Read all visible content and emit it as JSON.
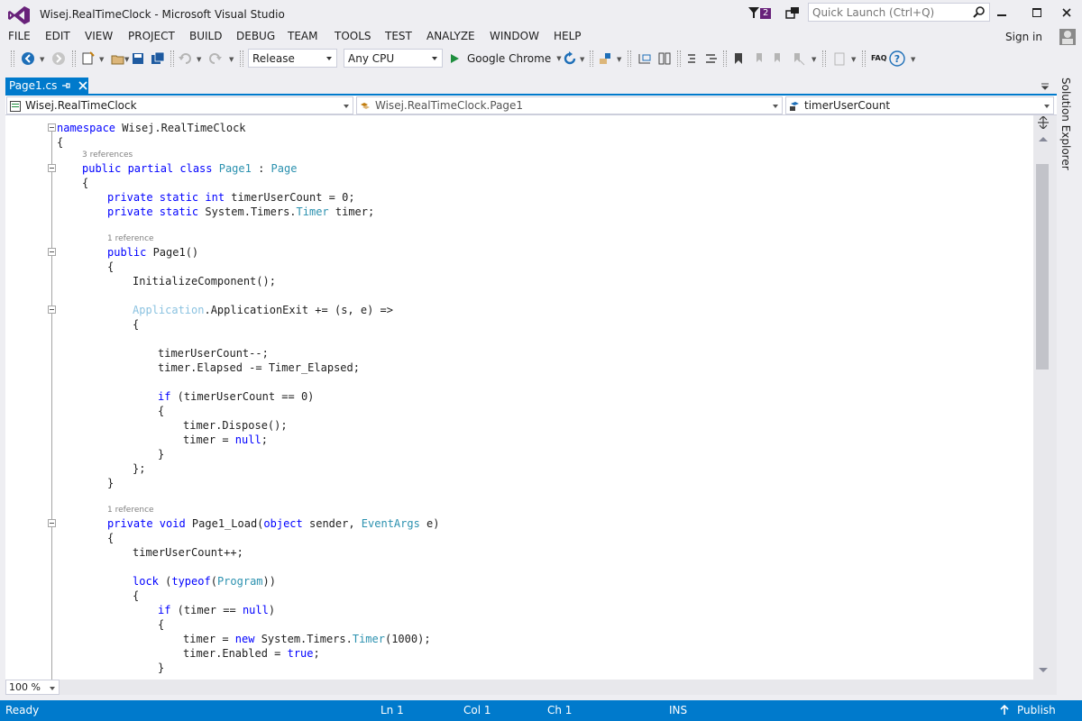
{
  "window": {
    "title": "Wisej.RealTimeClock - Microsoft Visual Studio",
    "notification_count": "2",
    "quick_launch_placeholder": "Quick Launch (Ctrl+Q)",
    "sign_in": "Sign in"
  },
  "menu": [
    "FILE",
    "EDIT",
    "VIEW",
    "PROJECT",
    "BUILD",
    "DEBUG",
    "TEAM",
    "TOOLS",
    "TEST",
    "ANALYZE",
    "WINDOW",
    "HELP"
  ],
  "toolbar": {
    "configuration": "Release",
    "platform": "Any CPU",
    "run_target": "Google Chrome",
    "faq": "FAQ"
  },
  "document_tab": {
    "label": "Page1.cs"
  },
  "navigation": {
    "project": "Wisej.RealTimeClock",
    "type": "Wisej.RealTimeClock.Page1",
    "member": "timerUserCount"
  },
  "editor": {
    "codelens": {
      "class_refs": "3 references",
      "ctor_refs": "1 reference",
      "load_refs": "1 reference"
    },
    "lines": {
      "l1": "Wisej.RealTimeClock",
      "ns_kw": "namespace",
      "class_mods": "public partial class",
      "class_name": "Page1",
      "base_class": "Page",
      "field1_mods": "private static int",
      "field1_rest": " timerUserCount = 0;",
      "field2_mods": "private static",
      "field2_mid": " System.Timers.",
      "field2_type": "Timer",
      "field2_rest": " timer;",
      "ctor_kw": "public",
      "ctor_rest": " Page1()",
      "init": "InitializeComponent();",
      "app": "Application",
      "app_rest": ".ApplicationExit += (s, e) =>",
      "dec": "timerUserCount--;",
      "unsub": "timer.Elapsed -= Timer_Elapsed;",
      "if_kw": "if",
      "if_rest": " (timerUserCount == 0)",
      "dispose": "timer.Dispose();",
      "assign_null_a": "timer = ",
      "null_kw": "null",
      "semi": ";",
      "close_lambda": "};",
      "load_mods": "private void",
      "load_name": " Page1_Load(",
      "object_kw": "object",
      "load_mid": " sender, ",
      "eventargs": "EventArgs",
      "load_end": " e)",
      "inc": "timerUserCount++;",
      "lock_kw": "lock",
      "lock_open": " (",
      "typeof_kw": "typeof",
      "program": "Program",
      "lock_close": "))",
      "if2_rest": " (timer == ",
      "if2_close": ")",
      "new_a": "timer = ",
      "new_kw": "new",
      "new_mid": " System.Timers.",
      "new_type": "Timer",
      "new_end": "(1000);",
      "enabled_a": "timer.Enabled = ",
      "true_kw": "true"
    }
  },
  "zoom": "100 %",
  "statusbar": {
    "state": "Ready",
    "ln": "Ln 1",
    "col": "Col 1",
    "ch": "Ch 1",
    "mode": "INS",
    "publish": "Publish"
  },
  "side_panel": {
    "label": "Solution Explorer"
  },
  "colors": {
    "accent": "#007acc",
    "keyword": "#0000ff",
    "type": "#2b91af",
    "vs_purple": "#68217a"
  }
}
